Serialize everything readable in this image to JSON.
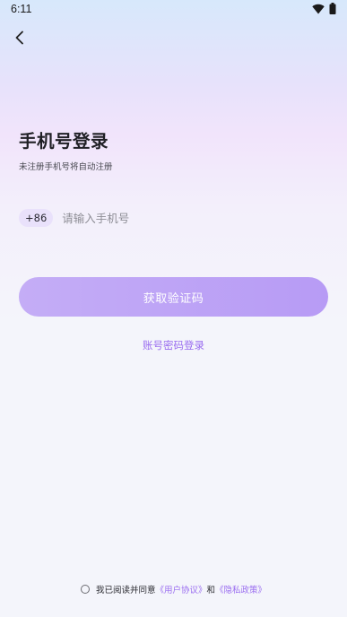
{
  "status_bar": {
    "time": "6:11"
  },
  "header": {
    "title": "手机号登录",
    "subtitle": "未注册手机号将自动注册"
  },
  "phone_form": {
    "country_code": "+86",
    "phone_placeholder": "请输入手机号",
    "phone_value": ""
  },
  "actions": {
    "get_code_label": "获取验证码",
    "password_login_label": "账号密码登录"
  },
  "agreement": {
    "prefix": "我已阅读并同意",
    "user_agreement": "《用户协议》",
    "conjunction": "和",
    "privacy_policy": "《隐私政策》"
  },
  "colors": {
    "accent": "#9a6df0",
    "button_start": "#c4adf6",
    "button_end": "#b79bf5",
    "code_chip": "#e9e1fb"
  },
  "icons": {
    "back": "chevron-left-icon",
    "wifi": "wifi-icon",
    "battery": "battery-icon",
    "checkbox": "radio-unchecked-icon"
  }
}
